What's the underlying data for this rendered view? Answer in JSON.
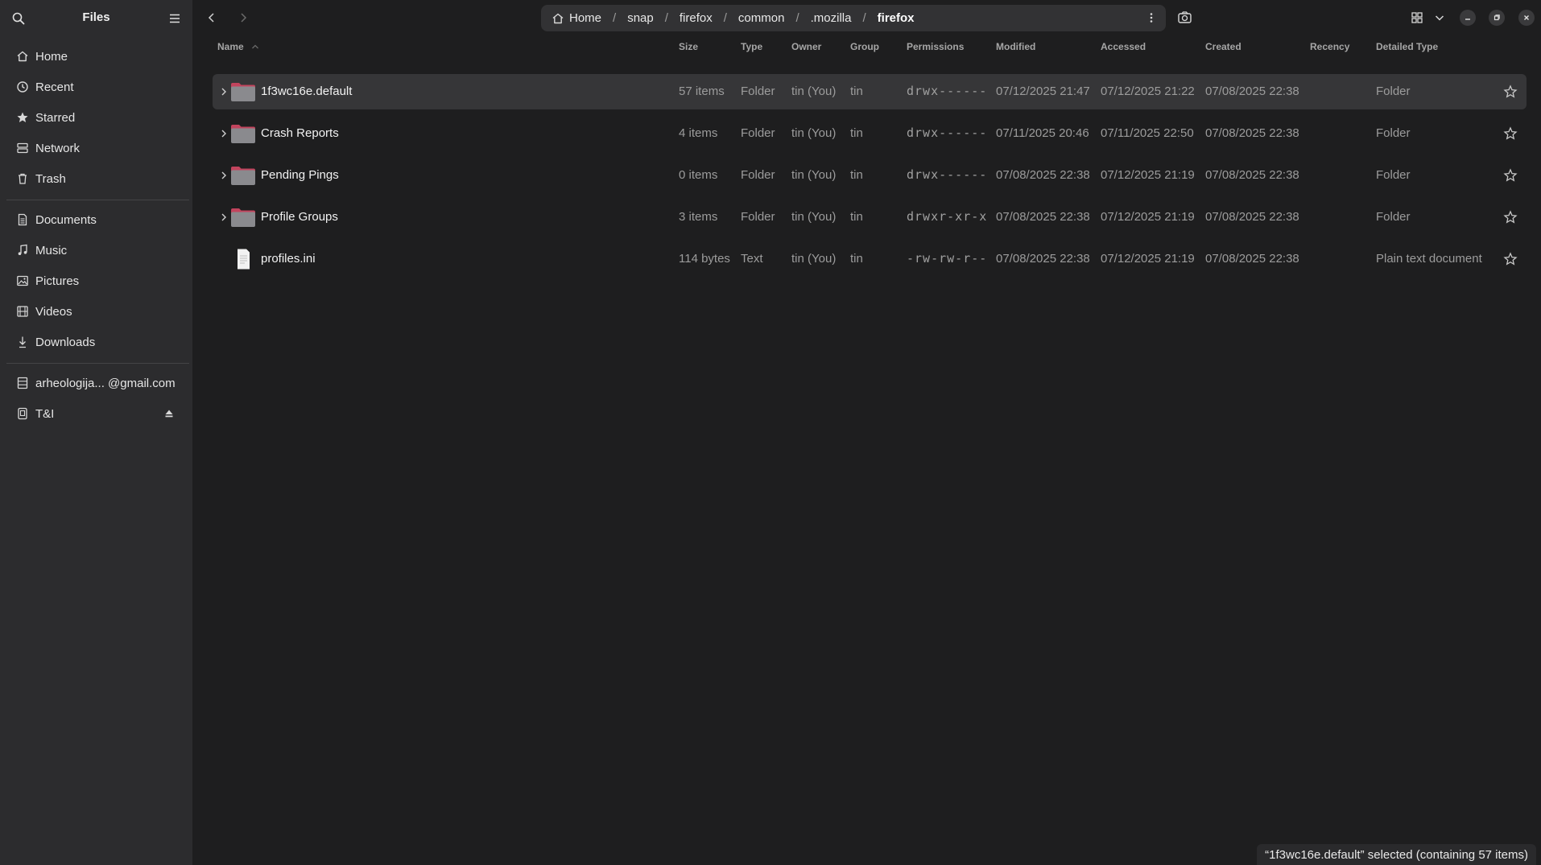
{
  "sidebar": {
    "title": "Files",
    "places": [
      {
        "label": "Home",
        "icon": "home-icon"
      },
      {
        "label": "Recent",
        "icon": "clock-icon"
      },
      {
        "label": "Starred",
        "icon": "star-icon"
      },
      {
        "label": "Network",
        "icon": "network-icon"
      },
      {
        "label": "Trash",
        "icon": "trash-icon"
      }
    ],
    "bookmarks": [
      {
        "label": "Documents",
        "icon": "document-icon"
      },
      {
        "label": "Music",
        "icon": "music-icon"
      },
      {
        "label": "Pictures",
        "icon": "picture-icon"
      },
      {
        "label": "Videos",
        "icon": "video-icon"
      },
      {
        "label": "Downloads",
        "icon": "download-icon"
      }
    ],
    "devices": [
      {
        "label": "arheologija... @gmail.com",
        "icon": "online-account-icon"
      },
      {
        "label": "T&I",
        "icon": "drive-icon"
      }
    ]
  },
  "pathbar": {
    "crumbs": [
      "Home",
      "snap",
      "firefox",
      "common",
      ".mozilla",
      "firefox"
    ]
  },
  "columns": {
    "name": "Name",
    "size": "Size",
    "type": "Type",
    "owner": "Owner",
    "group": "Group",
    "permissions": "Permissions",
    "modified": "Modified",
    "accessed": "Accessed",
    "created": "Created",
    "recency": "Recency",
    "detailed_type": "Detailed Type"
  },
  "files": [
    {
      "name": "1f3wc16e.default",
      "size": "57 items",
      "type": "Folder",
      "owner": "tin (You)",
      "group": "tin",
      "permissions": "drwx------",
      "modified": "07/12/2025 21:47",
      "accessed": "07/12/2025 21:22",
      "created": "07/08/2025 22:38",
      "recency": "",
      "detailed_type": "Folder",
      "kind": "folder",
      "selected": true
    },
    {
      "name": "Crash Reports",
      "size": "4 items",
      "type": "Folder",
      "owner": "tin (You)",
      "group": "tin",
      "permissions": "drwx------",
      "modified": "07/11/2025 20:46",
      "accessed": "07/11/2025 22:50",
      "created": "07/08/2025 22:38",
      "recency": "",
      "detailed_type": "Folder",
      "kind": "folder",
      "selected": false
    },
    {
      "name": "Pending Pings",
      "size": "0 items",
      "type": "Folder",
      "owner": "tin (You)",
      "group": "tin",
      "permissions": "drwx------",
      "modified": "07/08/2025 22:38",
      "accessed": "07/12/2025 21:19",
      "created": "07/08/2025 22:38",
      "recency": "",
      "detailed_type": "Folder",
      "kind": "folder",
      "selected": false
    },
    {
      "name": "Profile Groups",
      "size": "3 items",
      "type": "Folder",
      "owner": "tin (You)",
      "group": "tin",
      "permissions": "drwxr-xr-x",
      "modified": "07/08/2025 22:38",
      "accessed": "07/12/2025 21:19",
      "created": "07/08/2025 22:38",
      "recency": "",
      "detailed_type": "Folder",
      "kind": "folder",
      "selected": false
    },
    {
      "name": "profiles.ini",
      "size": "114 bytes",
      "type": "Text",
      "owner": "tin (You)",
      "group": "tin",
      "permissions": "-rw-rw-r--",
      "modified": "07/08/2025 22:38",
      "accessed": "07/12/2025 21:19",
      "created": "07/08/2025 22:38",
      "recency": "",
      "detailed_type": "Plain text document",
      "kind": "file",
      "selected": false
    }
  ],
  "status_text": "“1f3wc16e.default” selected  (containing 57 items)",
  "colors": {
    "folder": "#8a8a8e",
    "folder_tab": "#c2445d",
    "selection": "#363638"
  }
}
